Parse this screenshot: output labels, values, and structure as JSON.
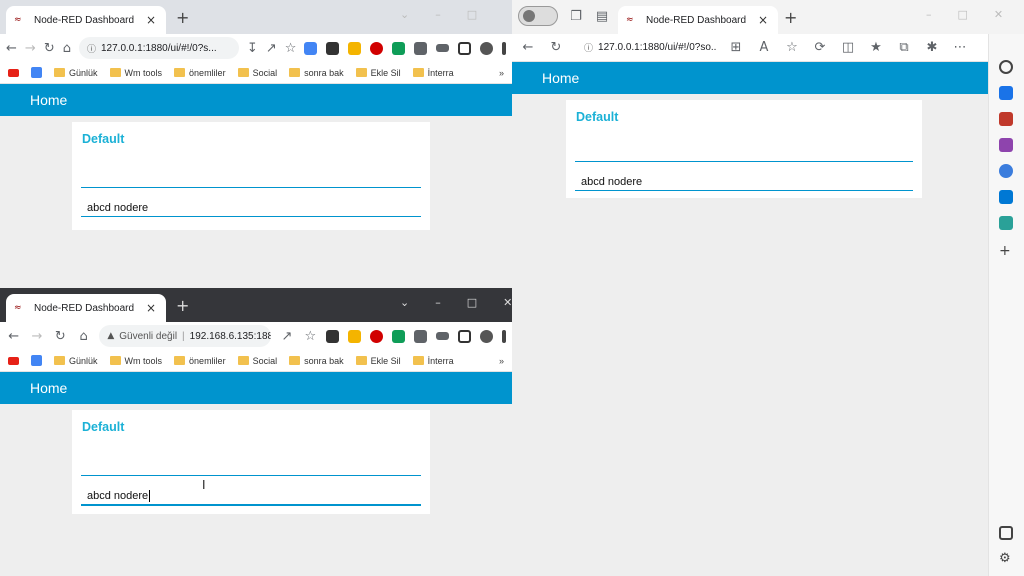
{
  "browser_top_left": {
    "tab_title": "Node-RED Dashboard",
    "url": "127.0.0.1:1880/ui/#!/0?s...",
    "bookmarks": [
      "Günlük",
      "Wm tools",
      "önemliler",
      "Social",
      "sonra bak",
      "Ekle Sil",
      "İnterra"
    ],
    "dashboard": {
      "header": "Home",
      "group_title": "Default",
      "text_value": "abcd nodere"
    }
  },
  "browser_bottom_left": {
    "tab_title": "Node-RED Dashboard",
    "security_label": "Güvenli değil",
    "url": "192.168.6.135:188...",
    "bookmarks": [
      "Günlük",
      "Wm tools",
      "önemliler",
      "Social",
      "sonra bak",
      "Ekle Sil",
      "İnterra"
    ],
    "dashboard": {
      "header": "Home",
      "group_title": "Default",
      "text_value": "abcd nodere"
    }
  },
  "browser_right": {
    "tab_title": "Node-RED Dashboard",
    "url": "127.0.0.1:1880/ui/#!/0?so...",
    "dashboard": {
      "header": "Home",
      "group_title": "Default",
      "text_value": "abcd nodere"
    }
  },
  "colors": {
    "header_bg": "#0094ce",
    "group_title": "#1bb1d6",
    "body_bg": "#eeeeee"
  }
}
